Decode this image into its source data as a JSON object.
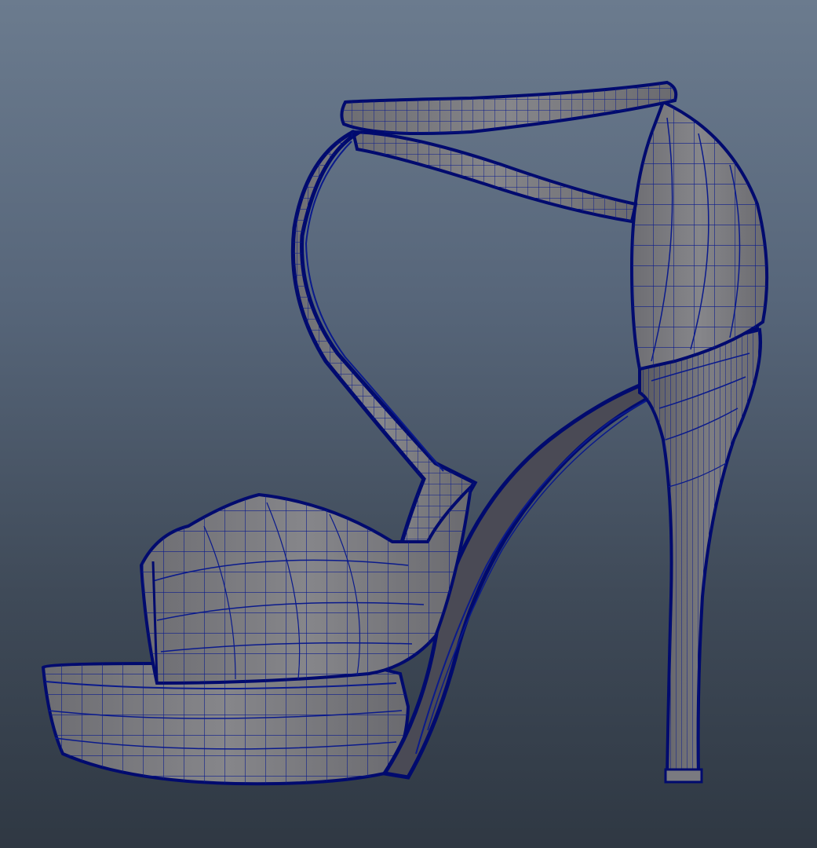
{
  "viewport": {
    "background_top": "#6b7b8e",
    "background_bottom": "#2f3843",
    "mesh_fill": "#7a7a7e",
    "mesh_shade": "#5e5e63",
    "wire_color": "#0a1a8c",
    "wire_outline": "#000a6e"
  },
  "model": {
    "object": "high-heel-sandal-mesh",
    "display_mode": "wireframe-on-shaded"
  }
}
